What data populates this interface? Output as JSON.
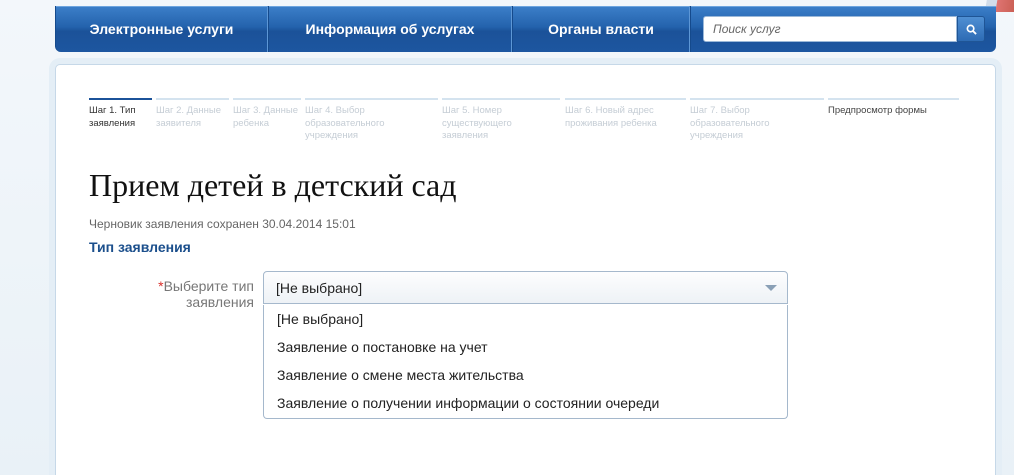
{
  "nav": {
    "items": [
      "Электронные услуги",
      "Информация об услугах",
      "Органы власти"
    ],
    "search_placeholder": "Поиск услуг"
  },
  "steps": [
    {
      "label": "Шаг 1. Тип заявления",
      "active": true
    },
    {
      "label": "Шаг 2. Данные заявителя"
    },
    {
      "label": "Шаг 3. Данные ребенка"
    },
    {
      "label": "Шаг 4. Выбор образовательного учреждения"
    },
    {
      "label": "Шаг 5. Номер существующего заявления"
    },
    {
      "label": "Шаг 6. Новый адрес проживания ребенка"
    },
    {
      "label": "Шаг 7. Выбор образовательного учреждения"
    },
    {
      "label": "Предпросмотр формы"
    }
  ],
  "page": {
    "title": "Прием детей в детский сад",
    "draft_note": "Черновик заявления сохранен 30.04.2014 15:01",
    "section_title": "Тип заявления"
  },
  "form": {
    "required_mark": "*",
    "field_label": "Выберите тип заявления",
    "selected_value": "[Не выбрано]",
    "options": [
      "[Не выбрано]",
      "Заявление о постановке на учет",
      "Заявление о смене места жительства",
      "Заявление о получении информации о состоянии очереди"
    ]
  },
  "icons": {
    "search": "search-icon",
    "dropdown": "chevron-down-icon"
  },
  "colors": {
    "nav_blue": "#2463ad",
    "heading_blue": "#1b4f8c",
    "required_red": "#d9302c"
  }
}
